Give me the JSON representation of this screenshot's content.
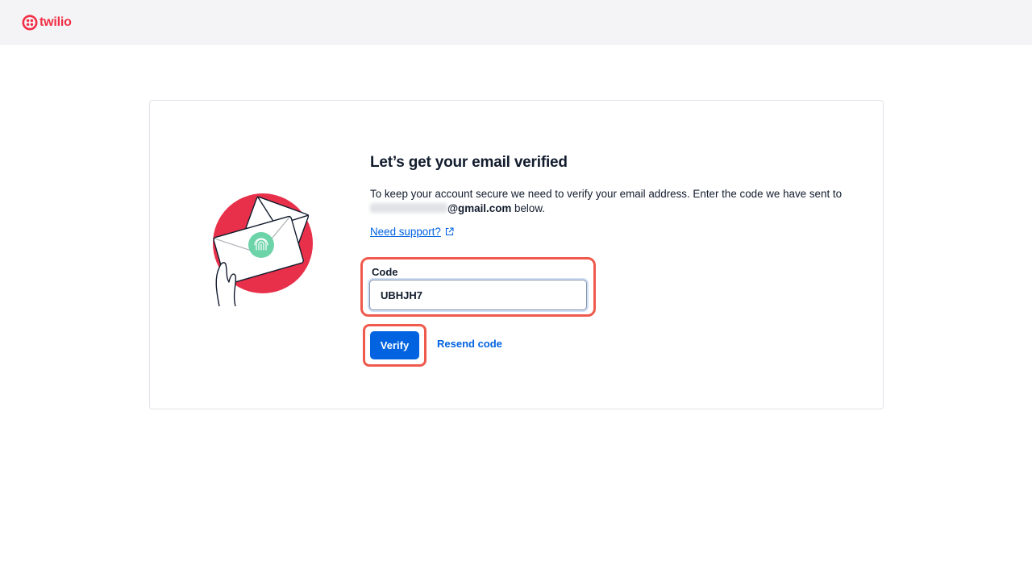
{
  "brand": {
    "name": "twilio",
    "color": "#f22f46"
  },
  "page": {
    "title": "Let’s get your email verified",
    "description_prefix": "To keep your account secure we need to verify your email address. Enter the code we have sent to",
    "email_domain": "@gmail.com",
    "description_suffix": " below.",
    "support_link": "Need support?"
  },
  "form": {
    "code_label": "Code",
    "code_value": "UBHJH7",
    "verify_label": "Verify",
    "resend_label": "Resend code"
  },
  "colors": {
    "accent": "#0263e0",
    "highlight": "#ef5a4d",
    "illustration_circle": "#e8304a",
    "illustration_badge": "#6dd3a8"
  },
  "icons": {
    "logo": "twilio-logo-icon",
    "external": "external-link-icon",
    "illustration": "email-fingerprint-illustration"
  }
}
